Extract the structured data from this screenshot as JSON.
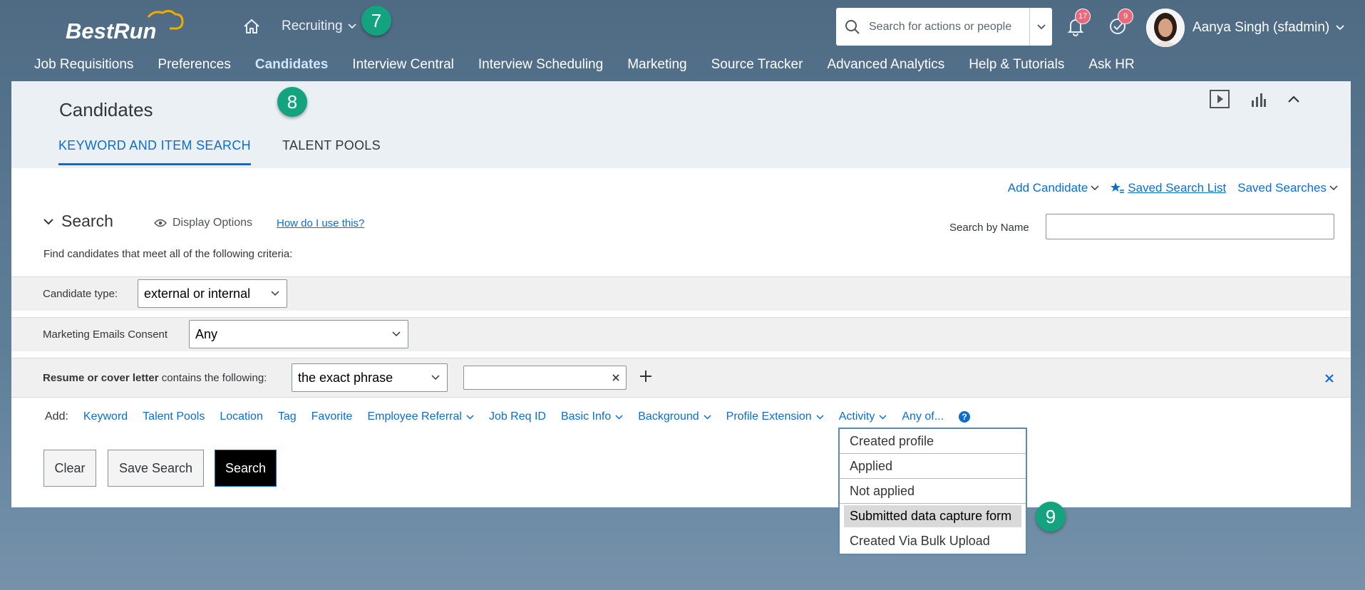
{
  "shell": {
    "logo_text": "BestRun",
    "module_label": "Recruiting",
    "search_placeholder": "Search for actions or people",
    "notifications_count": "17",
    "tasks_count": "9",
    "user_name": "Aanya Singh (sfadmin)"
  },
  "badges": {
    "module": "7",
    "candidates": "8",
    "dropdown": "9"
  },
  "nav": {
    "items": [
      "Job Requisitions",
      "Preferences",
      "Candidates",
      "Interview Central",
      "Interview Scheduling",
      "Marketing",
      "Source Tracker",
      "Advanced Analytics",
      "Help & Tutorials",
      "Ask HR"
    ],
    "active": "Candidates"
  },
  "page": {
    "title": "Candidates",
    "tabs": [
      "KEYWORD AND ITEM SEARCH",
      "TALENT POOLS"
    ]
  },
  "toolbar": {
    "add_candidate": "Add Candidate",
    "saved_search_list": "Saved Search List",
    "saved_searches": "Saved Searches"
  },
  "search": {
    "title": "Search",
    "display_options": "Display Options",
    "how_to": "How do I use this?",
    "search_by_name_label": "Search by Name",
    "search_by_name_value": "",
    "find_text": "Find candidates that meet all of the following criteria:"
  },
  "criteria": {
    "candidate_type_label": "Candidate type:",
    "candidate_type_value": "external or internal",
    "marketing_label": "Marketing Emails Consent",
    "marketing_value": "Any",
    "resume_label_bold": "Resume or cover letter",
    "resume_label_rest": " contains the following:",
    "resume_match_value": "the exact phrase",
    "resume_text_value": ""
  },
  "add_row": {
    "label": "Add:",
    "links": [
      "Keyword",
      "Talent Pools",
      "Location",
      "Tag",
      "Favorite"
    ],
    "dropdown_links": [
      "Employee Referral"
    ],
    "links2": [
      "Job Req ID"
    ],
    "dropdown_links2": [
      "Basic Info",
      "Background",
      "Profile Extension",
      "Activity"
    ],
    "any_of": "Any of...",
    "help": "?"
  },
  "buttons": {
    "clear": "Clear",
    "save_search": "Save Search",
    "search": "Search"
  },
  "activity_dropdown": {
    "items": [
      "Created profile",
      "Applied",
      "Not applied",
      "Submitted data capture form",
      "Created Via Bulk Upload"
    ],
    "highlighted": "Submitted data capture form"
  }
}
